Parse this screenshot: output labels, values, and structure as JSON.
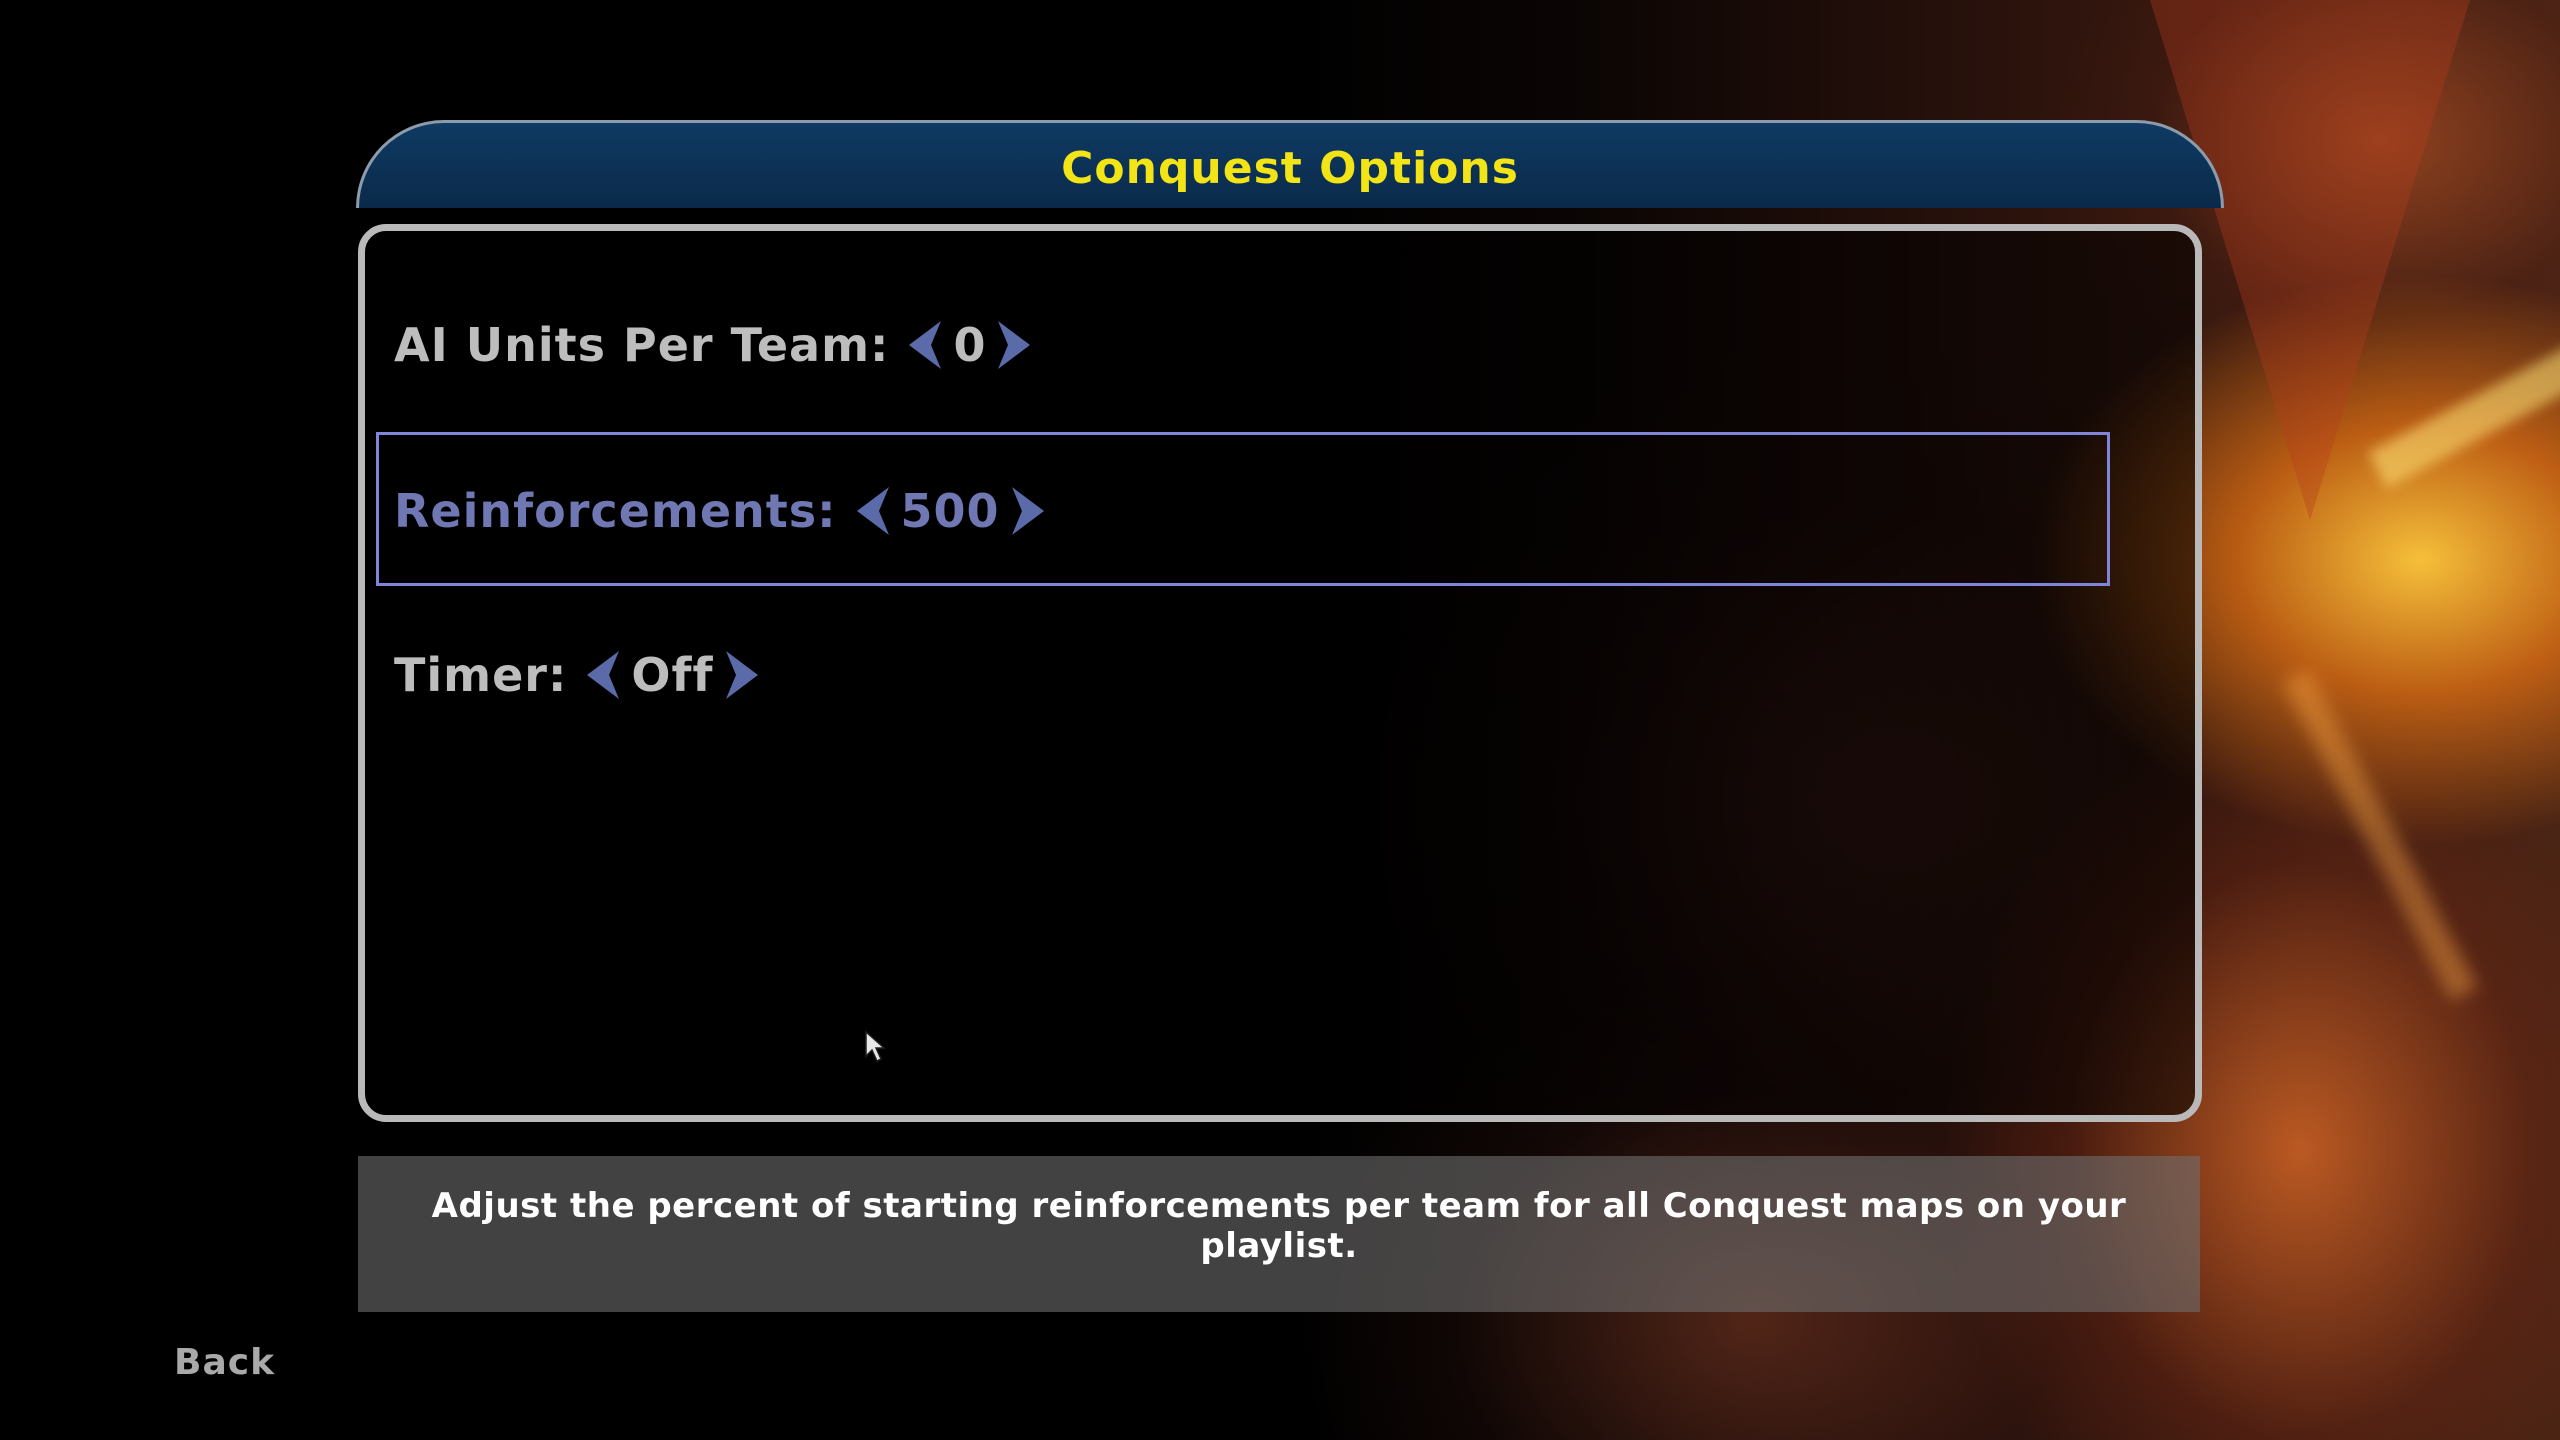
{
  "title": "Conquest Options",
  "options": [
    {
      "label": "AI Units Per Team:",
      "value": "0"
    },
    {
      "label": "Reinforcements:",
      "value": "500"
    },
    {
      "label": "Timer:",
      "value": "Off"
    }
  ],
  "selected_option": "Reinforcements:",
  "description": "Adjust the percent of starting reinforcements per team for all Conquest maps on your playlist.",
  "back_label": "Back",
  "icons": {
    "decrease": "left-arrow-icon",
    "increase": "right-arrow-icon",
    "cursor": "mouse-cursor-icon"
  },
  "colors": {
    "title_text": "#f2e416",
    "title_bar": "#0f3a63",
    "option_text": "#bdbdbd",
    "selected_text": "#7078b4",
    "selection_border": "#7f86da",
    "arrow": "#5b6aa8"
  }
}
